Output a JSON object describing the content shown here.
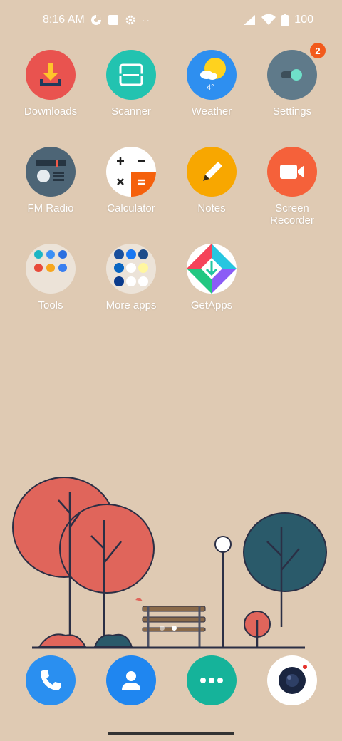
{
  "status_bar": {
    "time": "8:16 AM",
    "battery": "100"
  },
  "apps": [
    {
      "label": "Downloads",
      "icon": "download-icon",
      "color": "#e9534f"
    },
    {
      "label": "Scanner",
      "icon": "scanner-icon",
      "color": "#22c3b0"
    },
    {
      "label": "Weather",
      "icon": "weather-icon",
      "color": "#2e8ff0",
      "temp": "4°"
    },
    {
      "label": "Settings",
      "icon": "toggle-icon",
      "color": "#5f7a8a",
      "badge": "2"
    },
    {
      "label": "FM Radio",
      "icon": "radio-icon",
      "color": "#4d6576"
    },
    {
      "label": "Calculator",
      "icon": "calculator-icon",
      "color": "#ffffff"
    },
    {
      "label": "Notes",
      "icon": "pencil-icon",
      "color": "#f8a700"
    },
    {
      "label": "Screen Recorder",
      "icon": "video-camera-icon",
      "color": "#f5613a"
    },
    {
      "label": "Tools",
      "icon": "folder-icon",
      "color": "#ece3d8"
    },
    {
      "label": "More apps",
      "icon": "folder-icon",
      "color": "#ece3d8"
    },
    {
      "label": "GetApps",
      "icon": "getapps-icon",
      "color": "#ffffff"
    }
  ],
  "dock": [
    {
      "name": "phone",
      "color": "#2a8ff0"
    },
    {
      "name": "contacts",
      "color": "#1f86f0"
    },
    {
      "name": "messages",
      "color": "#15b39a"
    },
    {
      "name": "camera",
      "color": "#ffffff"
    }
  ]
}
